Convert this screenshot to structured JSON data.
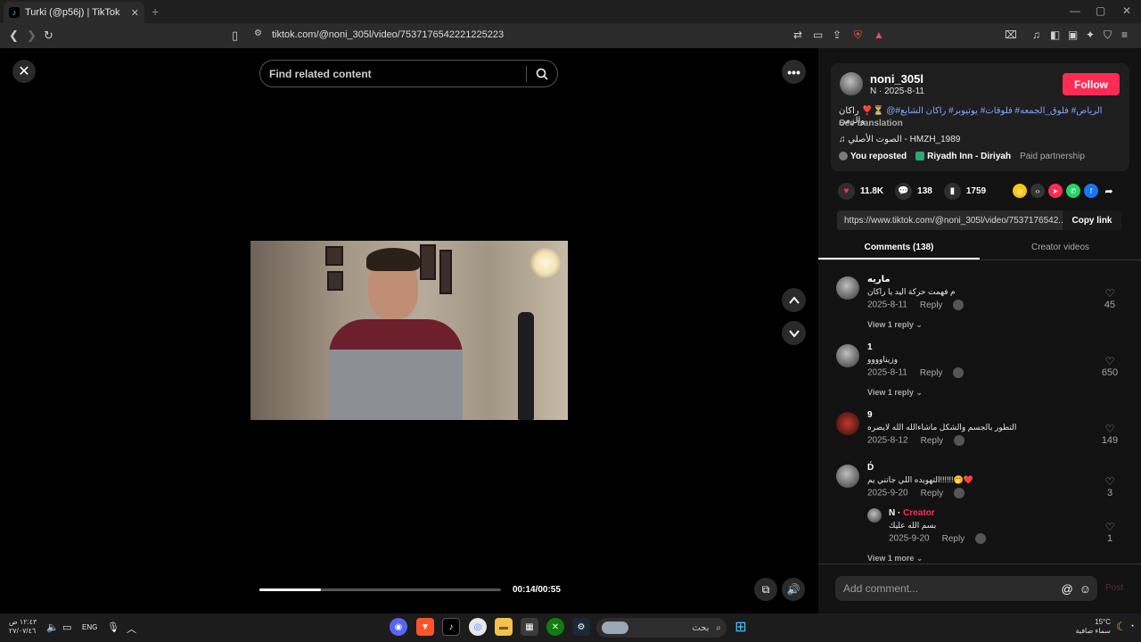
{
  "browser": {
    "tab_title": "Turki (@p56j) | TikTok",
    "tab_close": "✕",
    "new_tab": "+",
    "url": "tiktok.com/@noni_305l/video/7537176542221225223"
  },
  "player": {
    "search_placeholder": "Find related content",
    "time": "00:14/00:55",
    "progress": 0.255
  },
  "author": {
    "username": "noni_305l",
    "subline": "N · 2025-8-11",
    "follow_label": "Follow",
    "description_hashtags": "الرياض# فلوق_الجمعه# فلوقات# يوتيوبر# راكان الشايع#",
    "description_mention": "@",
    "description_tail": "راكان والزمن",
    "see_translation": "See translation",
    "music": "الصوت الأصلي - HMZH_1989",
    "reposted": "You reposted",
    "location": "Riyadh Inn - Diriyah",
    "paid": "Paid partnership"
  },
  "stats": {
    "likes": "11.8K",
    "comments": "138",
    "saves": "1759"
  },
  "link": {
    "url": "https://www.tiktok.com/@noni_305l/video/7537176542...",
    "copy_label": "Copy link"
  },
  "tabs": {
    "comments": "Comments (138)",
    "creator_videos": "Creator videos"
  },
  "comments": [
    {
      "name": "ماريه",
      "text": "م فهمت حركة اليد يا راكان",
      "date": "2025-8-11",
      "reply": "Reply",
      "likes": "45",
      "view": "View 1 reply"
    },
    {
      "name": "1",
      "text": "وزيناوووو",
      "date": "2025-8-11",
      "reply": "Reply",
      "likes": "650",
      "view": "View 1 reply"
    },
    {
      "name": "9",
      "text": "التطور بالجسم والشكل ماشاءالله الله لايضره",
      "date": "2025-8-12",
      "reply": "Reply",
      "likes": "149"
    },
    {
      "name": "D́",
      "text": "التهويده اللي جاتني يم!!!!!!🤭❤️",
      "date": "2025-9-20",
      "reply": "Reply",
      "likes": "3"
    }
  ],
  "creator_reply": {
    "name": "N",
    "tag": "Creator",
    "text": "بسم الله عليك",
    "date": "2025-9-20",
    "reply": "Reply",
    "likes": "1"
  },
  "view_more": "View 1 more",
  "add_comment": {
    "placeholder": "Add comment...",
    "post": "Post"
  },
  "taskbar": {
    "time": "١٢:٤٣ ص",
    "date": "٢٧/٠٧/٤٦",
    "lang": "ENG",
    "search": "بحث",
    "temp": "15°C",
    "weather": "سماء صافية"
  }
}
